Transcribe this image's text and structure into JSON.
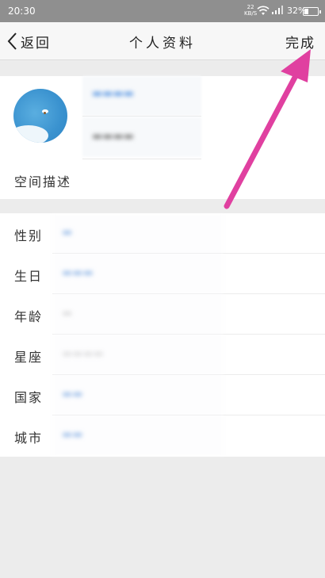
{
  "status_bar": {
    "time": "20:30",
    "speed": "22 KB/S",
    "battery_pct": "32%",
    "battery_level": 0.32
  },
  "nav": {
    "back_label": "返回",
    "title": "个人资料",
    "done_label": "完成"
  },
  "profile": {
    "nickname": "",
    "signature": "",
    "desc_label": "空间描述"
  },
  "info": {
    "rows": [
      {
        "label": "性别",
        "value": ""
      },
      {
        "label": "生日",
        "value": ""
      },
      {
        "label": "年龄",
        "value": ""
      },
      {
        "label": "星座",
        "value": ""
      },
      {
        "label": "国家",
        "value": ""
      },
      {
        "label": "城市",
        "value": ""
      }
    ]
  },
  "colors": {
    "arrow": "#e040a0",
    "status_bar_bg": "#8f8f8f"
  }
}
